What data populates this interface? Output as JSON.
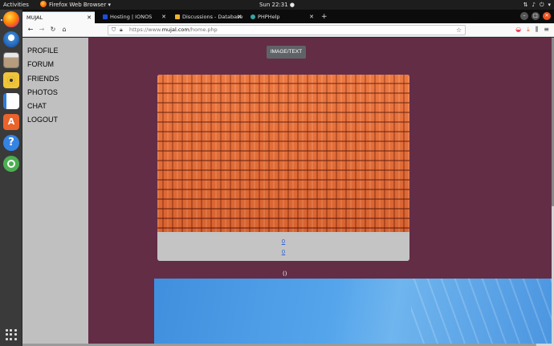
{
  "topbar": {
    "activities": "Activities",
    "app_name": "Firefox Web Browser ▾",
    "clock": "Sun 22:31 ●"
  },
  "dock": {
    "apps": [
      "firefox-icon",
      "thunderbird-icon",
      "files-icon",
      "rhythmbox-icon",
      "writer-icon",
      "software-center-icon",
      "help-icon",
      "chrome-icon",
      "show-apps-icon"
    ]
  },
  "tabs": [
    {
      "label": "MUJAL",
      "active": true
    },
    {
      "label": "Hosting | IONOS",
      "active": false
    },
    {
      "label": "Discussions - Database D",
      "active": false
    },
    {
      "label": "PHPHelp",
      "active": false
    }
  ],
  "url": {
    "prefix": "https://www.",
    "domain": "mujal.com",
    "path": "/home.php"
  },
  "sidebar": {
    "items": [
      "PROFILE",
      "FORUM",
      "FRIENDS",
      "PHOTOS",
      "CHAT",
      "LOGOUT"
    ]
  },
  "main": {
    "image_text_button": "IMAGE/TEXT",
    "card_links": [
      "0",
      "0"
    ],
    "paren_text": "()"
  },
  "colors": {
    "page_bg": "#632d46",
    "sidebar_bg": "#c0c0c0",
    "card_bg": "#c4c4c4",
    "button_bg": "#5f6368"
  }
}
